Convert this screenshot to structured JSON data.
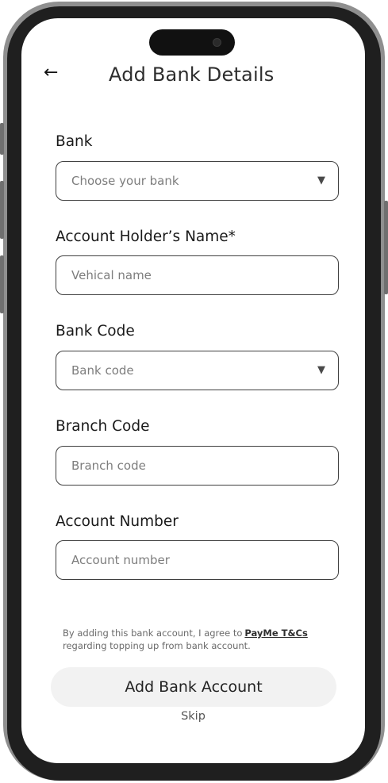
{
  "header": {
    "back_icon": "←",
    "title": "Add Bank Details"
  },
  "form": {
    "bank": {
      "label": "Bank",
      "placeholder": "Choose your bank",
      "caret": "▼"
    },
    "holder": {
      "label": "Account Holder’s Name*",
      "placeholder": "Vehical name"
    },
    "bank_code": {
      "label": "Bank Code",
      "placeholder": "Bank code",
      "caret": "▼"
    },
    "branch_code": {
      "label": "Branch Code",
      "placeholder": "Branch code"
    },
    "account_number": {
      "label": "Account Number",
      "placeholder": "Account number"
    }
  },
  "terms": {
    "text_line1": "By adding this bank account, I agree to",
    "link": "PayMe T&Cs",
    "text_line2": "regarding topping up from bank account."
  },
  "actions": {
    "primary": "Add Bank Account",
    "skip": "Skip"
  }
}
